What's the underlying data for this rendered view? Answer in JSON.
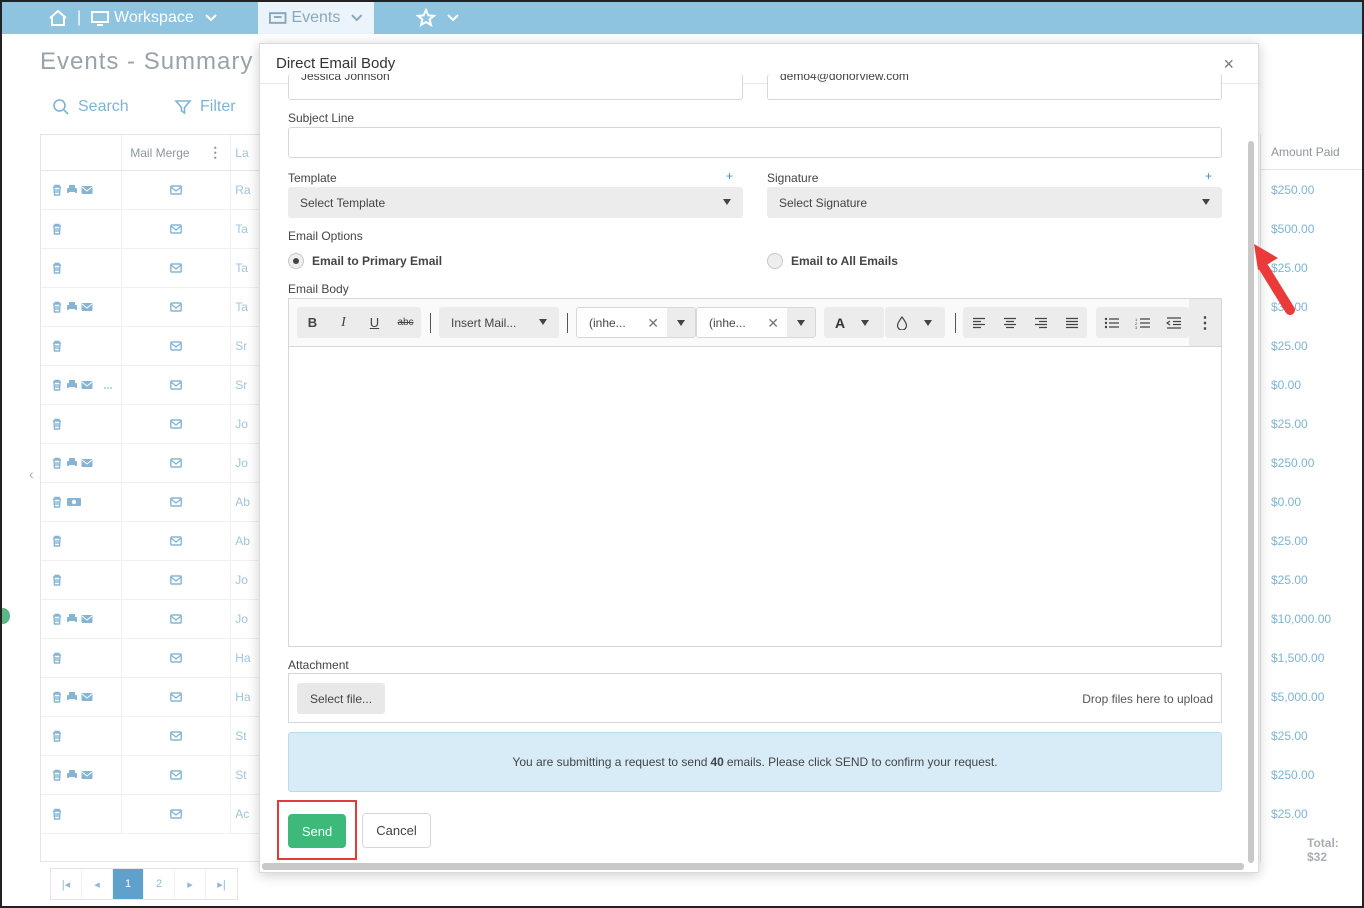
{
  "nav": {
    "workspace_label": "Workspace",
    "events_label": "Events"
  },
  "page": {
    "title": "Events - Summary",
    "search_label": "Search",
    "filter_label": "Filter",
    "col_mail_merge": "Mail Merge",
    "col_last_prefix": "La",
    "col_amount": "Amount Paid",
    "row_name_prefixes": [
      "Ra",
      "Ta",
      "Ta",
      "Ta",
      "Sr",
      "Sr",
      "Jo",
      "Jo",
      "Ab",
      "Ab",
      "Jo",
      "Jo",
      "Ha",
      "Ha",
      "St",
      "St",
      "Ac"
    ],
    "row_icon_sets": [
      "trash,print,mail",
      "trash",
      "trash",
      "trash,print,mail",
      "trash",
      "trash,print,mail,more",
      "trash",
      "trash,print,mail",
      "trash,money",
      "trash",
      "trash",
      "trash,print,mail",
      "trash",
      "trash,print,mail",
      "trash",
      "trash,print,mail",
      "trash"
    ],
    "amounts": [
      "$250.00",
      "$500.00",
      "$25.00",
      "$30.00",
      "$25.00",
      "$0.00",
      "$25.00",
      "$250.00",
      "$0.00",
      "$25.00",
      "$25.00",
      "$10,000.00",
      "$1,500.00",
      "$5,000.00",
      "$25.00",
      "$250.00",
      "$25.00"
    ],
    "total_label": "Total: $32",
    "pages": [
      "1",
      "2"
    ]
  },
  "modal": {
    "title": "Direct Email Body",
    "from_name": "Jessica Johnson",
    "from_email": "demo4@donorview.com",
    "subject_label": "Subject Line",
    "subject_value": "",
    "template_label": "Template",
    "template_value": "Select Template",
    "signature_label": "Signature",
    "signature_value": "Select Signature",
    "plus": "+",
    "email_options_label": "Email Options",
    "option_primary": "Email to Primary Email",
    "option_all": "Email to All Emails",
    "selected_option": "primary",
    "email_body_label": "Email Body",
    "toolbar": {
      "bold": "B",
      "italic": "I",
      "underline": "U",
      "strike": "abc",
      "insert_mail": "Insert Mail...",
      "font_family": "(inhe...",
      "font_size": "(inhe...",
      "font_color": "A",
      "more": "⋮"
    },
    "attachment_label": "Attachment",
    "select_file_label": "Select file...",
    "drop_hint": "Drop files here to upload",
    "info_before": "You are submitting a request to send",
    "info_count": "40",
    "info_after": "emails. Please click SEND to confirm your request.",
    "send_label": "Send",
    "cancel_label": "Cancel",
    "close_label": "×"
  },
  "colors": {
    "nav_bar": "#8ec4df",
    "send_button": "#3db97a",
    "highlight_box": "#e23b3b",
    "info_bg": "#d7ecf7"
  }
}
